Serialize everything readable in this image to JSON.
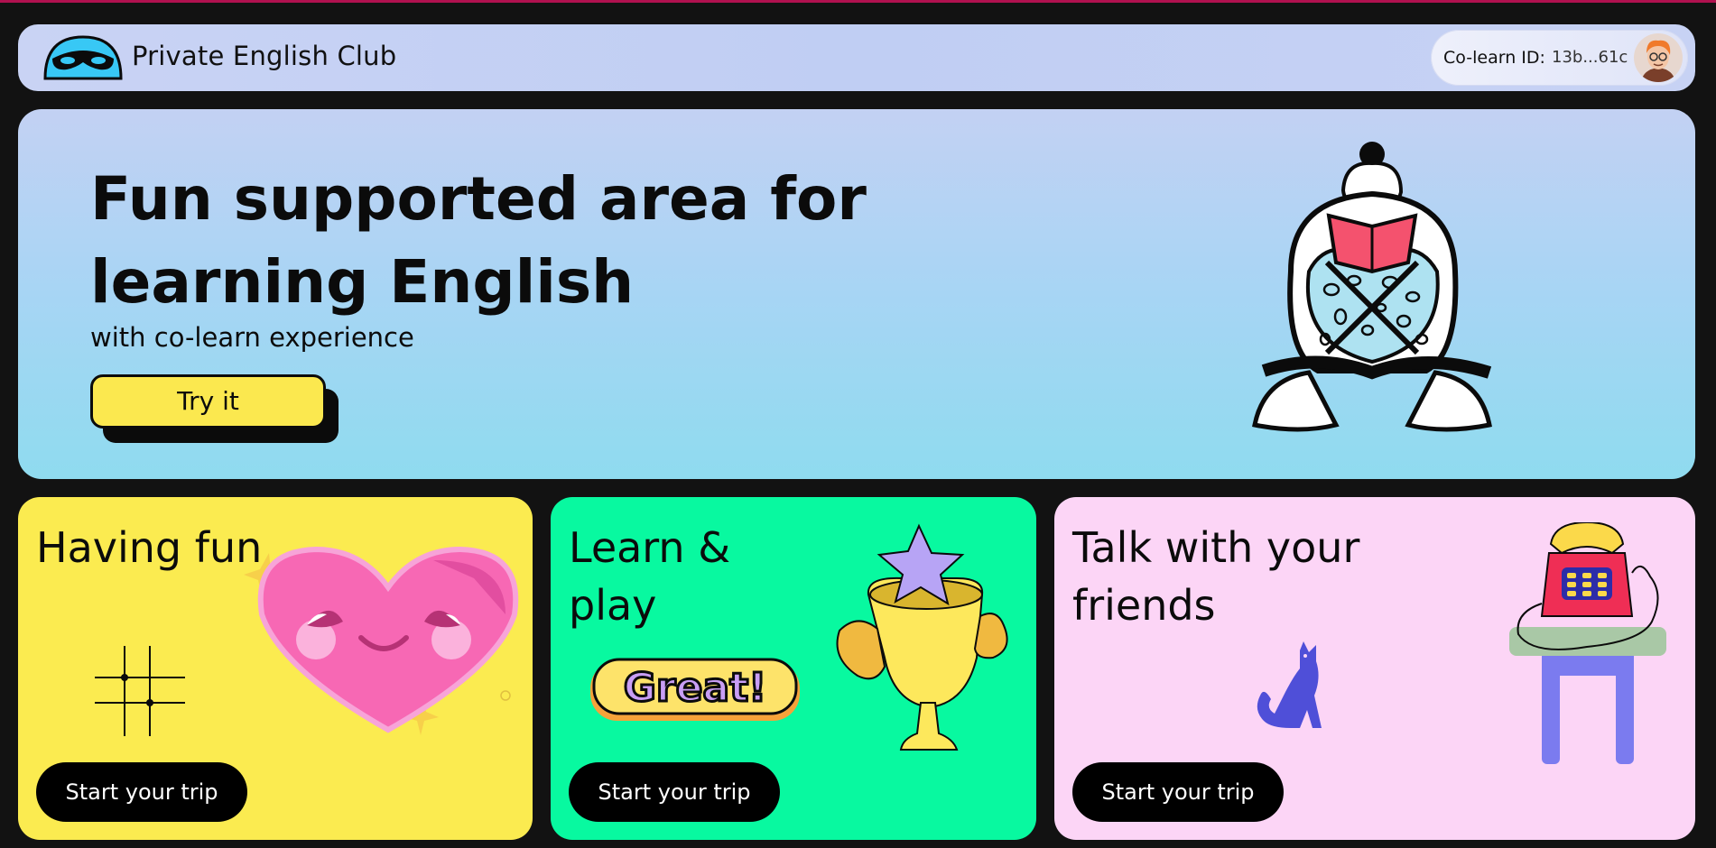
{
  "header": {
    "app_title": "Private English Club",
    "colearn_label": "Co-learn ID:",
    "colearn_id": "13b...61c"
  },
  "hero": {
    "title": "Fun supported area for learning English",
    "subtitle": "with co-learn experience",
    "cta_label": "Try it"
  },
  "cards": [
    {
      "title": "Having fun",
      "button_label": "Start your trip",
      "color": "#fbeb50"
    },
    {
      "title": "Learn & play",
      "button_label": "Start your trip",
      "color": "#08f9a0",
      "sticker_text": "Great!"
    },
    {
      "title": "Talk with your friends",
      "button_label": "Start your trip",
      "color": "#fcd5f6"
    }
  ],
  "icons": [
    "mask-logo-icon",
    "avatar",
    "reading-person-illustration",
    "heart-illustration",
    "grid-doodle-icon",
    "trophy-illustration",
    "great-sticker",
    "telephone-illustration",
    "cat-illustration"
  ]
}
